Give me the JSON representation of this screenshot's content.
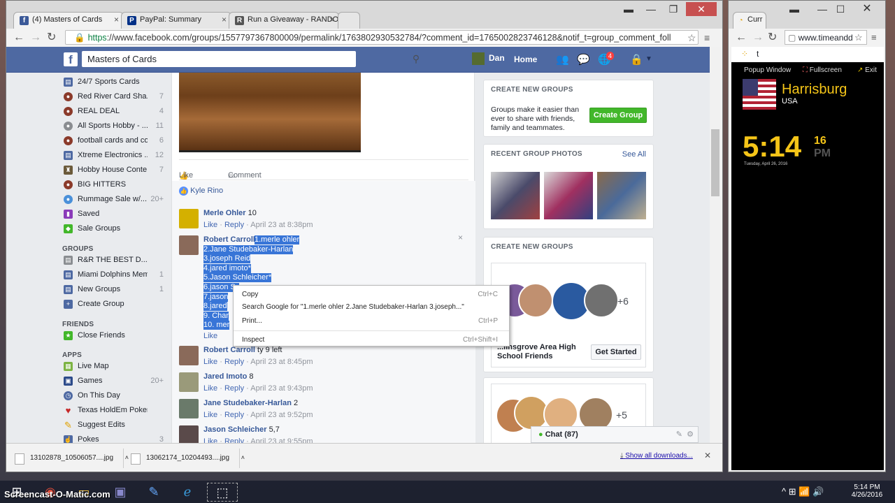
{
  "browser": {
    "tabs": [
      {
        "label": "(4) Masters of Cards",
        "fav": "f",
        "favcolor": "#3b5998"
      },
      {
        "label": "PayPal: Summary",
        "fav": "P",
        "favcolor": "#003087"
      },
      {
        "label": "Run a Giveaway - RANDO",
        "fav": "R",
        "favcolor": "#555555"
      }
    ],
    "url_https": "https",
    "url_rest": "://www.facebook.com/groups/1557797367800009/permalink/1763802930532784/?comment_id=1765002823746128&notif_t=group_comment_foll"
  },
  "fb": {
    "search_value": "Masters of Cards",
    "profile_name": "Dan",
    "home_label": "Home",
    "notif_count": "4"
  },
  "leftnav": {
    "items": [
      {
        "label": "24/7 Sports Cards",
        "count": "",
        "icon": "group-icon"
      },
      {
        "label": "Red River Card Sha...",
        "count": "7",
        "icon": "football-icon"
      },
      {
        "label": "REAL DEAL",
        "count": "4",
        "icon": "football-icon"
      },
      {
        "label": "All Sports Hobby - ...",
        "count": "11",
        "icon": "sports-ball-icon"
      },
      {
        "label": "football cards and co...",
        "count": "6",
        "icon": "football-icon"
      },
      {
        "label": "Xtreme Electronics ...",
        "count": "12",
        "icon": "group-icon"
      },
      {
        "label": "Hobby House Conte...",
        "count": "7",
        "icon": "trophy-icon"
      },
      {
        "label": "BIG HITTERS",
        "count": "",
        "icon": "football-icon"
      },
      {
        "label": "Rummage Sale w/...",
        "count": "20+",
        "icon": "globe-icon"
      },
      {
        "label": "Saved",
        "count": "",
        "icon": "bookmark-icon"
      },
      {
        "label": "Sale Groups",
        "count": "",
        "icon": "tag-icon"
      }
    ],
    "groups_heading": "GROUPS",
    "groups": [
      {
        "label": "R&R THE BEST D...",
        "count": "",
        "icon": "group-icon"
      },
      {
        "label": "Miami Dolphins Mem...",
        "count": "1",
        "icon": "group-icon"
      },
      {
        "label": "New Groups",
        "count": "1",
        "icon": "group-icon"
      },
      {
        "label": "Create Group",
        "count": "",
        "icon": "plus-icon"
      }
    ],
    "friends_heading": "FRIENDS",
    "friends": [
      {
        "label": "Close Friends",
        "count": "",
        "icon": "star-icon"
      }
    ],
    "apps_heading": "APPS",
    "apps": [
      {
        "label": "Live Map",
        "count": "",
        "icon": "map-icon"
      },
      {
        "label": "Games",
        "count": "20+",
        "icon": "games-icon"
      },
      {
        "label": "On This Day",
        "count": "",
        "icon": "clock-icon"
      },
      {
        "label": "Texas HoldEm Poker",
        "count": "",
        "icon": "heart-icon"
      },
      {
        "label": "Suggest Edits",
        "count": "",
        "icon": "pencil-icon"
      },
      {
        "label": "Pokes",
        "count": "3",
        "icon": "poke-icon"
      }
    ]
  },
  "post": {
    "like_label": "Like",
    "comment_label": "Comment",
    "liker": "Kyle Rino"
  },
  "comments": [
    {
      "name": "Merle Ohler",
      "text": "10",
      "time": "April 23 at 8:38pm"
    },
    {
      "name": "Robert Carroll",
      "text": "",
      "time": ""
    },
    {
      "name": "Robert Carroll",
      "text": "ty 9 left",
      "time": "April 23 at 8:45pm"
    },
    {
      "name": "Jared Imoto",
      "text": "8",
      "time": "April 23 at 9:43pm"
    },
    {
      "name": "Jane Studebaker-Harlan",
      "text": "2",
      "time": "April 23 at 9:52pm"
    },
    {
      "name": "Jason Schleicher",
      "text": "5,7",
      "time": "April 23 at 9:55pm"
    }
  ],
  "selected_lines": [
    "1.merle ohler",
    "2.Jane Studebaker-Harlan",
    "3.joseph Reid",
    "4.jared imoto*",
    "5.Jason Schleicher*",
    "6.jason Sc",
    "7.jason",
    "8.jared",
    "9. Char",
    "10. mer"
  ],
  "action_like": "Like",
  "action_reply": "Reply",
  "action_sep": "·",
  "context_menu": {
    "copy": "Copy",
    "copy_key": "Ctrl+C",
    "search": "Search Google for \"1.merle ohler 2.Jane Studebaker-Harlan 3.joseph...\"",
    "print": "Print...",
    "print_key": "Ctrl+P",
    "inspect": "Inspect",
    "inspect_key": "Ctrl+Shift+I"
  },
  "right": {
    "create_title": "CREATE NEW GROUPS",
    "create_text": "Groups make it easier than ever to share with friends, family and teammates.",
    "create_button": "Create Group",
    "photos_title": "RECENT GROUP PHOTOS",
    "see_all": "See All",
    "create_title2": "CREATE NEW GROUPS",
    "plus6": "+6",
    "suggest_name": "...linsgrove Area High School Friends",
    "get_started": "Get Started",
    "plus5": "+5"
  },
  "chat_label": "Chat (87)",
  "downloads": [
    {
      "name": "13102878_10506057....jpg"
    },
    {
      "name": "13062174_10204493....jpg"
    }
  ],
  "show_all_downloads": "Show all downloads...",
  "timeanddate": {
    "tab": "Curr",
    "url": "www.timeandd",
    "popup": "Popup Window",
    "fullscreen": "Fullscreen",
    "exit": "Exit",
    "city": "Harrisburg",
    "country": "USA",
    "time": "5:14",
    "seconds": "16",
    "ampm": "PM",
    "date": "Tuesday, April 26, 2016"
  },
  "taskbar": {
    "watermark": "Screencast-O-Matic.com",
    "clock_time": "5:14 PM",
    "clock_date": "4/26/2016"
  }
}
